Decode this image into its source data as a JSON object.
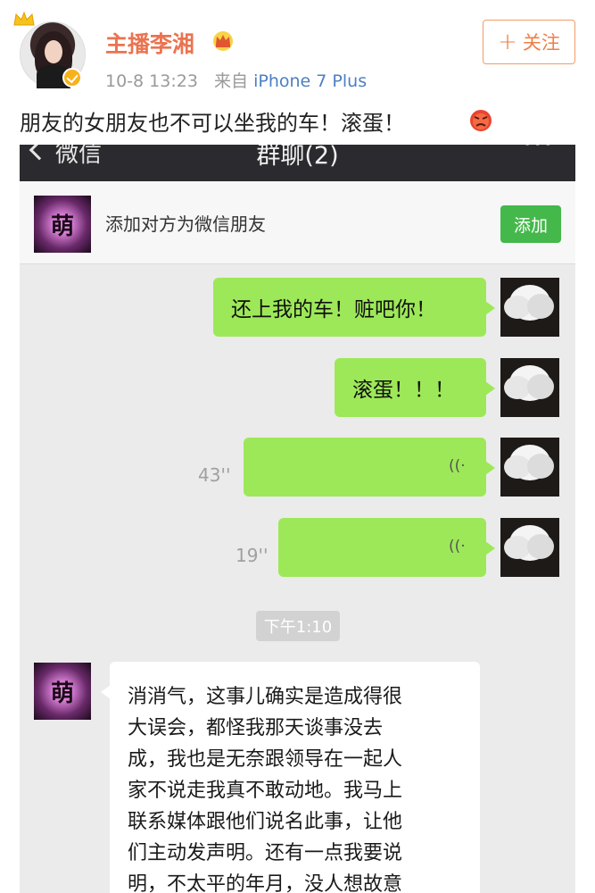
{
  "post": {
    "username": "主播李湘",
    "timestamp": "10-8 13:23",
    "source_prefix": "来自",
    "device": "iPhone 7 Plus",
    "follow_label": "关注",
    "text": "朋友的女朋友也不可以坐我的车！滚蛋！",
    "icons": [
      "crown-icon",
      "verified-badge-icon",
      "angry-emoji-icon"
    ],
    "accent_color": "#eb7350"
  },
  "wechat": {
    "nav": {
      "back_label": "微信",
      "title": "群聊(2)",
      "more": "···"
    },
    "add_friend": {
      "avatar_text": "萌",
      "label": "添加对方为微信朋友",
      "button": "添加"
    },
    "messages": [
      {
        "sender": "self",
        "type": "text",
        "text": "还上我的车！赃吧你！"
      },
      {
        "sender": "self",
        "type": "text",
        "text": "滚蛋！！！"
      },
      {
        "sender": "self",
        "type": "voice",
        "duration": "43''"
      },
      {
        "sender": "self",
        "type": "voice",
        "duration": "19''"
      }
    ],
    "time_divider": "下午1:10",
    "reply": {
      "avatar_text": "萌",
      "lines": [
        "消消气，这事儿确实是造成得很",
        "大误会，都怪我那天谈事没去",
        "成，我也是无奈跟领导在一起人",
        "家不说走我真不敢动地。我马上",
        "联系媒体跟他们说名此事，让他",
        "们主动发声明。还有一点我要说",
        "明，不太平的年月，没人想故意"
      ]
    },
    "colors": {
      "bubble_green": "#9de858",
      "add_button": "#44b84a",
      "nav_bg": "#2b2b2f"
    }
  }
}
